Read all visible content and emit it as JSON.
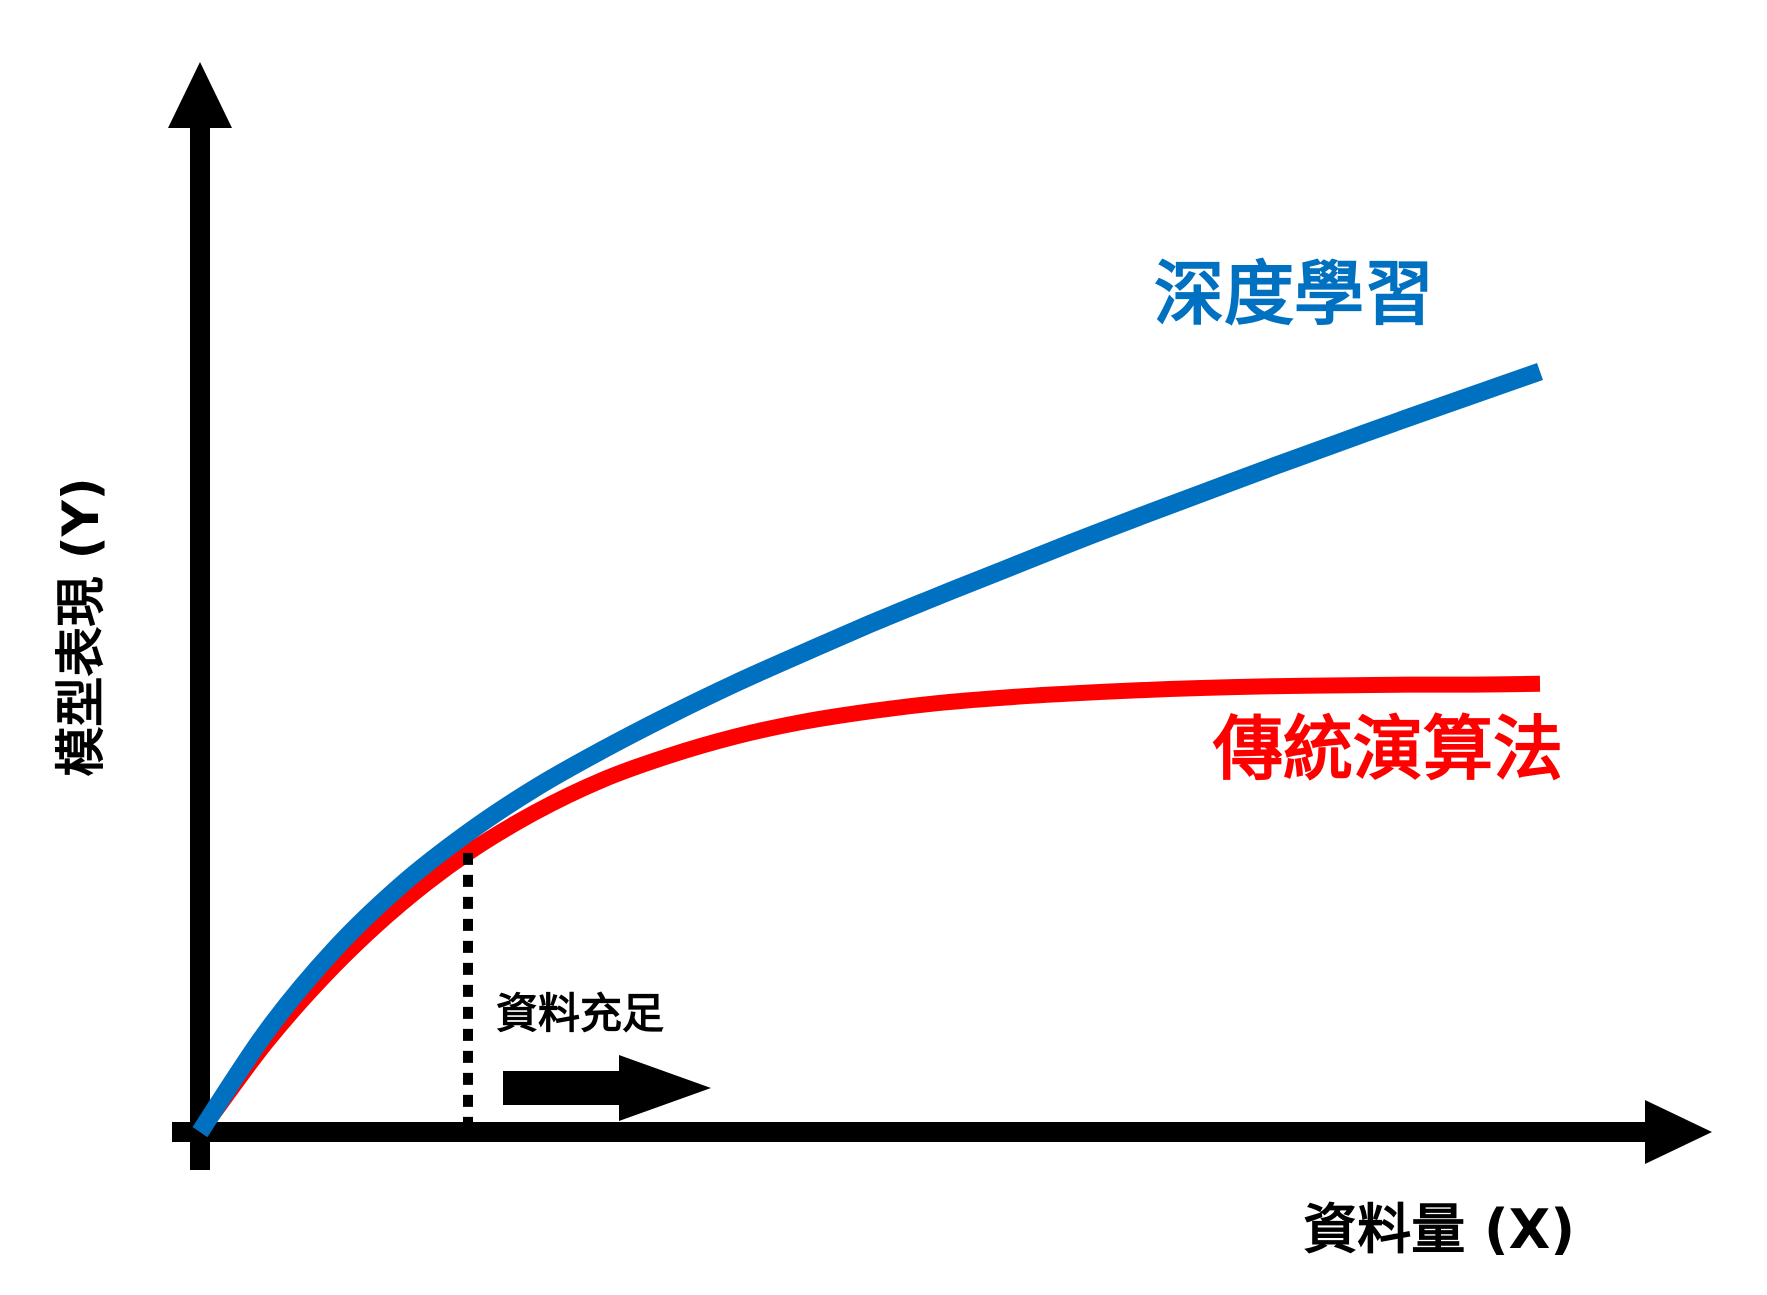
{
  "chart_data": {
    "type": "line",
    "title": "",
    "xlabel": "資料量 (X)",
    "ylabel": "模型表現 (Y)",
    "xlim": [
      0,
      10
    ],
    "ylim": [
      0,
      10
    ],
    "grid": false,
    "legend": "inline-labels",
    "series": [
      {
        "name": "深度學習",
        "color": "#0070C0",
        "x": [
          0,
          0.5,
          1,
          1.5,
          2,
          2.5,
          3,
          3.5,
          4,
          4.5,
          5,
          5.5,
          6,
          6.5,
          7,
          7.5,
          8,
          8.5,
          9,
          9.5,
          10
        ],
        "y": [
          0,
          1.25,
          2.25,
          3.05,
          3.7,
          4.25,
          4.72,
          5.15,
          5.55,
          5.92,
          6.28,
          6.62,
          6.95,
          7.28,
          7.6,
          7.91,
          8.22,
          8.52,
          8.82,
          9.11,
          9.4
        ]
      },
      {
        "name": "傳統演算法",
        "color": "#FF0000",
        "x": [
          0,
          0.5,
          1,
          1.5,
          2,
          2.5,
          3,
          3.5,
          4,
          4.5,
          5,
          5.5,
          6,
          6.5,
          7,
          7.5,
          8,
          8.5,
          9,
          9.5,
          10
        ],
        "y": [
          0,
          1.12,
          2.05,
          2.82,
          3.45,
          3.95,
          4.35,
          4.65,
          4.89,
          5.07,
          5.2,
          5.3,
          5.37,
          5.42,
          5.46,
          5.49,
          5.51,
          5.52,
          5.53,
          5.53,
          5.54
        ]
      }
    ],
    "annotations": [
      {
        "text": "資料充足",
        "x": 2,
        "style": "dotted vertical line with right arrow"
      }
    ]
  }
}
